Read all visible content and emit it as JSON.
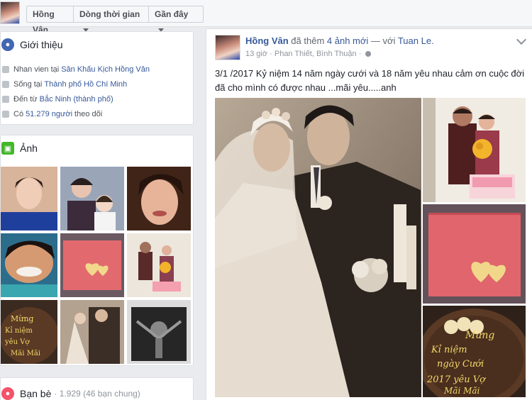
{
  "topbar": {
    "name_button": "Hồng Vân",
    "timeline_button": "Dòng thời gian",
    "recent_button": "Gần đây"
  },
  "intro": {
    "title": "Giới thiệu",
    "rows": [
      {
        "prefix": "Nhan vien tại",
        "link": "Sân Khấu Kịch Hồng Vân"
      },
      {
        "prefix": "Sống tại",
        "link": "Thành phố Hồ Chí Minh"
      },
      {
        "prefix": "Đến từ",
        "link": "Bắc Ninh (thành phố)"
      },
      {
        "prefix": "Có",
        "link": "51.279 người",
        "suffix": "theo dõi"
      }
    ]
  },
  "photos": {
    "title": "Ảnh",
    "thumb_icons": [
      "portrait-photo",
      "family-photo",
      "smiling-woman-photo",
      "caricature-photo",
      "red-card-photo",
      "couple-cake-photo",
      "cake-photo",
      "wedding-photo",
      "poster-photo"
    ]
  },
  "friends": {
    "title": "Bạn bè",
    "count_text": "· 1.929 (46 bạn chung)"
  },
  "post": {
    "author": "Hồng Vân",
    "action_prefix": "đã thêm",
    "action_link": "4 ảnh mới",
    "with_text": "— với",
    "tagged": "Tuan Le.",
    "time": "13 giờ",
    "location": "· Phan Thiết, Bình Thuận ·",
    "text": "3/1 /2017 Kỷ niệm 14 năm ngày cưới và 18 năm yêu nhau cảm ơn cuộc đời đã cho mình có được nhau ...mãi yêu.....anh",
    "cake_text": [
      "Mừng",
      "Kỉ niệm",
      "ngày Cưới",
      "2017 yêu Vợ",
      "Mãi Mãi"
    ]
  },
  "colors": {
    "link": "#365899",
    "bg": "#e9ebee",
    "accent_blue": "#4267b2",
    "photo_green": "#42b72a"
  }
}
